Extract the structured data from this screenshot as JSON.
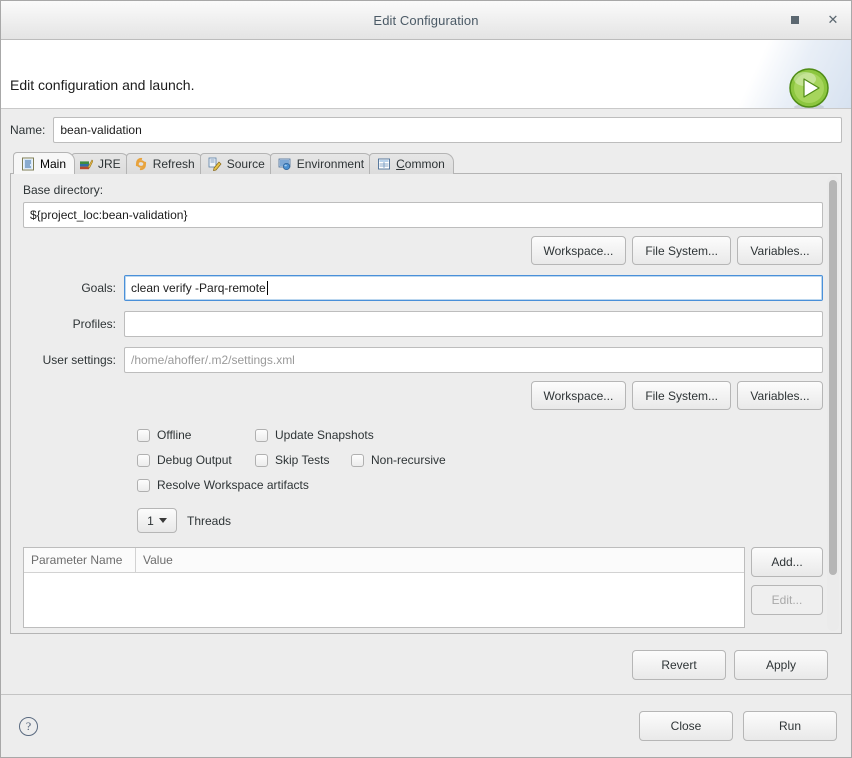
{
  "window": {
    "title": "Edit Configuration",
    "maximize_icon": "maximize-icon",
    "close_icon": "close-icon"
  },
  "banner": {
    "title": "Edit configuration and launch.",
    "icon": "run-launch-icon"
  },
  "name_row": {
    "label": "Name:",
    "value": "bean-validation"
  },
  "tabs": [
    {
      "label": "Main",
      "icon": "main-tab-icon",
      "active": true
    },
    {
      "label": "JRE",
      "icon": "jre-tab-icon",
      "active": false
    },
    {
      "label": "Refresh",
      "icon": "refresh-tab-icon",
      "active": false
    },
    {
      "label": "Source",
      "icon": "source-tab-icon",
      "active": false
    },
    {
      "label": "Environment",
      "icon": "environment-tab-icon",
      "active": false
    },
    {
      "label": "Common",
      "icon": "common-tab-icon",
      "active": false,
      "mnemonic": "C"
    }
  ],
  "main": {
    "base_directory": {
      "label": "Base directory:",
      "value": "${project_loc:bean-validation}"
    },
    "browse_buttons_top": [
      {
        "label": "Workspace..."
      },
      {
        "label": "File System..."
      },
      {
        "label": "Variables..."
      }
    ],
    "goals": {
      "label": "Goals:",
      "value": "clean verify -Parq-remote",
      "focused": true
    },
    "profiles": {
      "label": "Profiles:",
      "value": ""
    },
    "user_settings": {
      "label": "User settings:",
      "placeholder": "/home/ahoffer/.m2/settings.xml",
      "value": ""
    },
    "browse_buttons_bottom": [
      {
        "label": "Workspace..."
      },
      {
        "label": "File System..."
      },
      {
        "label": "Variables..."
      }
    ],
    "checkboxes": [
      [
        {
          "label": "Offline",
          "checked": false
        },
        {
          "label": "Update Snapshots",
          "checked": false
        }
      ],
      [
        {
          "label": "Debug Output",
          "checked": false
        },
        {
          "label": "Skip Tests",
          "checked": false
        },
        {
          "label": "Non-recursive",
          "checked": false
        }
      ],
      [
        {
          "label": "Resolve Workspace artifacts",
          "checked": false
        }
      ]
    ],
    "threads": {
      "value": "1",
      "label": "Threads"
    },
    "parameters_table": {
      "columns": [
        "Parameter Name",
        "Value"
      ],
      "rows": []
    },
    "table_buttons": [
      {
        "label": "Add...",
        "enabled": true
      },
      {
        "label": "Edit...",
        "enabled": false
      }
    ]
  },
  "apply_row": [
    {
      "label": "Revert"
    },
    {
      "label": "Apply"
    }
  ],
  "footer": {
    "help_icon": "help-icon",
    "help_glyph": "?",
    "buttons": [
      {
        "label": "Close"
      },
      {
        "label": "Run"
      }
    ]
  },
  "colors": {
    "accent": "#4a90d9",
    "run_green": "#6ab023",
    "window_bg": "#ededed",
    "field_bg": "#ffffff"
  }
}
